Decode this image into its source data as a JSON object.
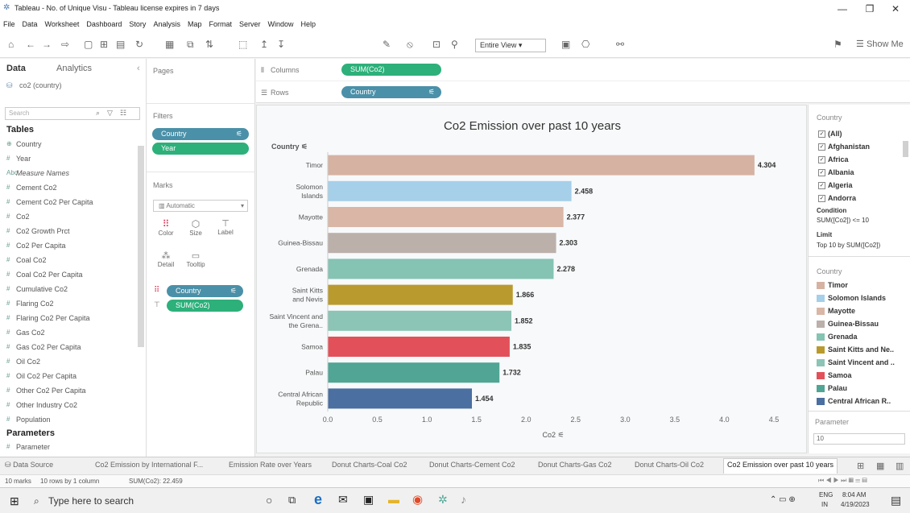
{
  "window": {
    "title": "Tableau - No. of Unique Visu - Tableau license expires in 7 days"
  },
  "menu": [
    "File",
    "Data",
    "Worksheet",
    "Dashboard",
    "Story",
    "Analysis",
    "Map",
    "Format",
    "Server",
    "Window",
    "Help"
  ],
  "toolbar": {
    "view_select": "Entire View",
    "show_me": "Show Me"
  },
  "data_pane": {
    "tab_data": "Data",
    "tab_analytics": "Analytics",
    "datasource": "co2 (country)",
    "search_placeholder": "Search",
    "tables_heading": "Tables",
    "fields": [
      "Country",
      "Year",
      "Measure Names",
      "Cement Co2",
      "Cement Co2 Per Capita",
      "Co2",
      "Co2 Growth Prct",
      "Co2 Per Capita",
      "Coal Co2",
      "Coal Co2 Per Capita",
      "Cumulative Co2",
      "Flaring Co2",
      "Flaring Co2 Per Capita",
      "Gas Co2",
      "Gas Co2 Per Capita",
      "Oil Co2",
      "Oil Co2 Per Capita",
      "Other Co2 Per Capita",
      "Other Industry Co2",
      "Population"
    ],
    "parameters_heading": "Parameters",
    "parameter_item": "Parameter"
  },
  "shelves": {
    "pages": "Pages",
    "filters": "Filters",
    "filter_pills": [
      "Country",
      "Year"
    ],
    "marks": "Marks",
    "mark_type": "Automatic",
    "mark_buttons": [
      "Color",
      "Size",
      "Label",
      "Detail",
      "Tooltip"
    ],
    "mark_pills": [
      "Country",
      "SUM(Co2)"
    ],
    "columns": "Columns",
    "rows": "Rows",
    "columns_pill": "SUM(Co2)",
    "rows_pill": "Country"
  },
  "chart_data": {
    "type": "bar",
    "orientation": "horizontal",
    "title": "Co2 Emission over past 10 years",
    "ylabel": "Country",
    "xlabel": "Co2",
    "xlim": [
      0,
      4.5
    ],
    "xticks": [
      "0.0",
      "0.5",
      "1.0",
      "1.5",
      "2.0",
      "2.5",
      "3.0",
      "3.5",
      "4.0",
      "4.5"
    ],
    "categories": [
      "Timor",
      "Solomon Islands",
      "Mayotte",
      "Guinea-Bissau",
      "Grenada",
      "Saint Kitts and Nevis",
      "Saint Vincent and the Grena..",
      "Samoa",
      "Palau",
      "Central African Republic"
    ],
    "values": [
      4.304,
      2.458,
      2.377,
      2.303,
      2.278,
      1.866,
      1.852,
      1.835,
      1.732,
      1.454
    ],
    "value_labels": [
      "4.304",
      "2.458",
      "2.377",
      "2.303",
      "2.278",
      "1.866",
      "1.852",
      "1.835",
      "1.732",
      "1.454"
    ],
    "colors": [
      "#d6b2a3",
      "#a6cfe9",
      "#d9b6a6",
      "#bcb0ab",
      "#85c3b3",
      "#b99a2e",
      "#8cc4b5",
      "#e2515a",
      "#50a595",
      "#4a6fa0"
    ]
  },
  "filter_card": {
    "title": "Country",
    "items": [
      "(All)",
      "Afghanistan",
      "Africa",
      "Albania",
      "Algeria",
      "Andorra"
    ],
    "condition_label": "Condition",
    "condition_value": "SUM([Co2]) <= 10",
    "limit_label": "Limit",
    "limit_value": "Top 10 by SUM([Co2])"
  },
  "legend": {
    "title": "Country",
    "items": [
      "Timor",
      "Solomon Islands",
      "Mayotte",
      "Guinea-Bissau",
      "Grenada",
      "Saint Kitts and Ne..",
      "Saint Vincent and ..",
      "Samoa",
      "Palau",
      "Central African R.."
    ]
  },
  "parameter_card": {
    "title": "Parameter",
    "value": "10"
  },
  "sheet_tabs": [
    "Data Source",
    "Co2 Emission by International F...",
    "Emission Rate over Years",
    "Donut Charts-Coal Co2",
    "Donut Charts-Cement Co2",
    "Donut Charts-Gas Co2",
    "Donut Charts-Oil Co2",
    "Co2 Emission over past 10 years"
  ],
  "status": {
    "marks": "10 marks",
    "rows": "10 rows by 1 column",
    "sum": "SUM(Co2): 22.459"
  },
  "taskbar": {
    "search_placeholder": "Type here to search",
    "lang": "ENG",
    "region": "IN",
    "time": "8:04 AM",
    "date": "4/19/2023"
  }
}
